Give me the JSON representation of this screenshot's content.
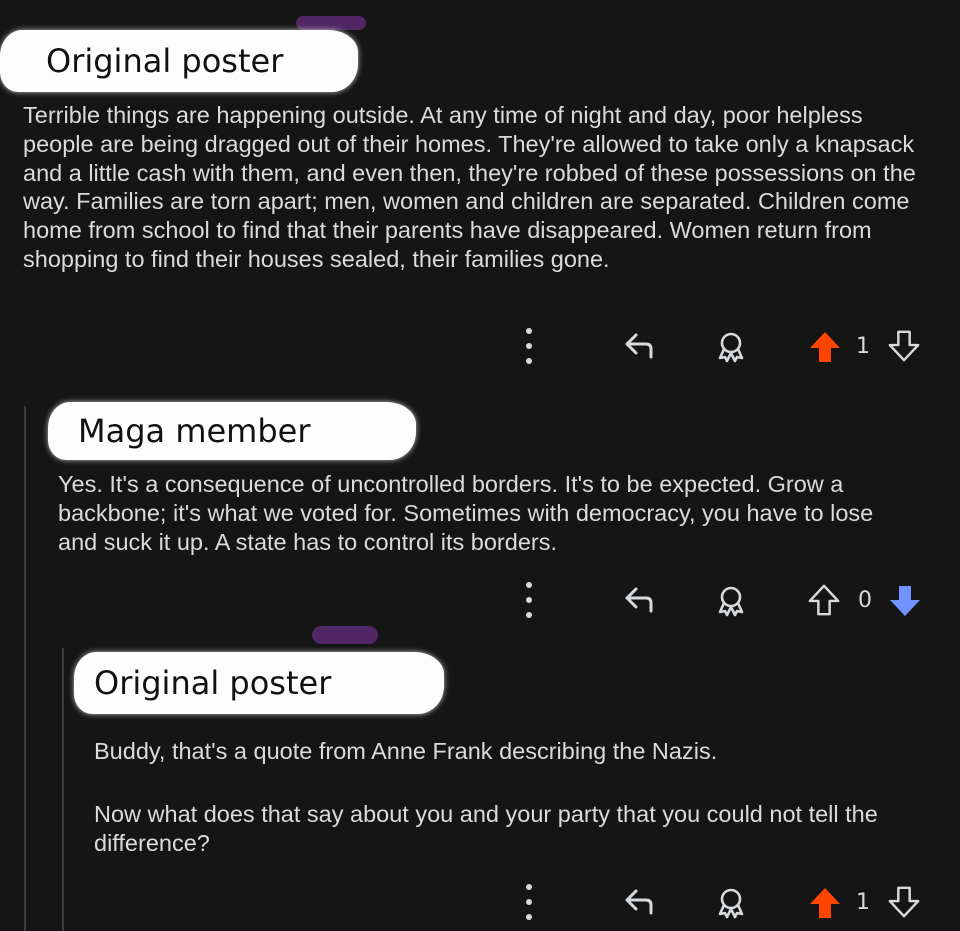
{
  "colors": {
    "background": "#151516",
    "text": "#d9dbdc",
    "upvote_active": "#ff4500",
    "downvote_active": "#7193ff",
    "thread_line": "#3a3a3c",
    "name_redaction": "#fdfdfd"
  },
  "comments": [
    {
      "author": "Original poster",
      "paragraphs": [
        "Terrible things are happening outside. At any time of night and day, poor helpless people are being dragged out of their homes. They're allowed to take only a knapsack and a little cash with them, and even then, they're robbed of these possessions on the way. Families are torn apart; men, women and children are separated. Children come home from school to find that their parents have disappeared. Women return from shopping to find their houses sealed, their families gone."
      ],
      "score": "1",
      "vote_state": "upvoted"
    },
    {
      "author": "Maga member",
      "paragraphs": [
        "Yes.  It's a consequence of uncontrolled borders.  It's to be expected.  Grow a backbone; it's what we voted for.  Sometimes with democracy, you have to lose and suck it up.  A state has to control its borders."
      ],
      "score": "0",
      "vote_state": "downvoted"
    },
    {
      "author": "Original poster",
      "paragraphs": [
        "Buddy, that's a quote from Anne Frank describing the Nazis.",
        "Now what does that say about you and your party that you could not tell the difference?"
      ],
      "score": "1",
      "vote_state": "upvoted"
    }
  ],
  "icons": {
    "more": "more-options-icon",
    "reply": "reply-icon",
    "award": "award-icon",
    "upvote": "upvote-arrow-icon",
    "downvote": "downvote-arrow-icon"
  }
}
